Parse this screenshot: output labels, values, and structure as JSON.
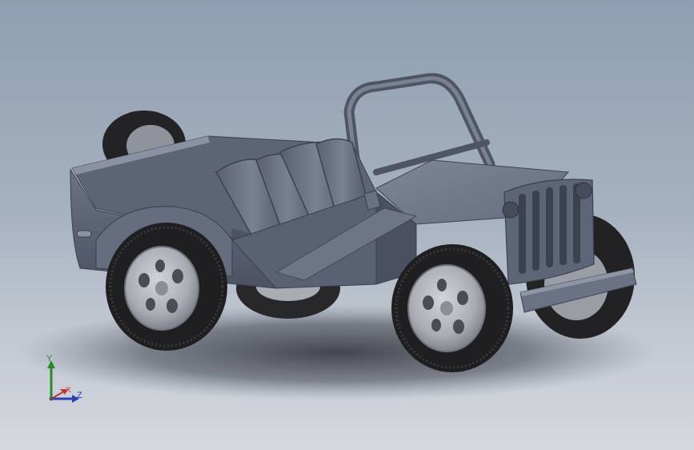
{
  "viewport": {
    "background_top": "#8f9fb1",
    "background_bottom": "#d4d8de",
    "model_color": "#5d6473",
    "tire_color": "#262628",
    "rim_color": "#b3b6bc"
  },
  "triad": {
    "y_label": "Y",
    "x_label": "X",
    "z_label": "Z",
    "y_color": "#2a8a2a",
    "x_color": "#c23030",
    "z_color": "#2a3fb8"
  }
}
